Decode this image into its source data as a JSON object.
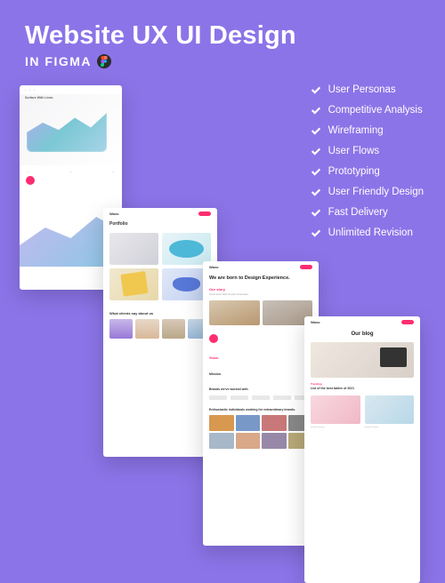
{
  "header": {
    "title": "Website UX UI Design",
    "subtitle": "IN FIGMA"
  },
  "features": [
    "User Personas",
    "Competitive Analysis",
    "Wireframing",
    "User Flows",
    "Prototyping",
    "User Friendly Design",
    "Fast Delivery",
    "Unlimited Revision"
  ],
  "mockups": {
    "card1": {
      "hero_label": "Surface With Lines"
    },
    "card2": {
      "logo": "Wavo",
      "section_title": "Portfolio",
      "testimonial_title": "What clients say about us"
    },
    "card3": {
      "logo": "Wavo",
      "heading": "We are born to\nDesign Experience.",
      "story_label": "Our story",
      "vision_label": "Vision.",
      "mission_label": "Mission.",
      "brands_label": "Brands we've worked with",
      "team_heading": "Enthusiastic individuals working for extraordinary brands."
    },
    "card4": {
      "logo": "Wavo",
      "title": "Our blog",
      "category": "Trending",
      "article_title": "List of the best tables of 2021"
    }
  },
  "colors": {
    "background": "#8b74e8",
    "accent": "#ff2d6f",
    "text_light": "#ffffff"
  }
}
